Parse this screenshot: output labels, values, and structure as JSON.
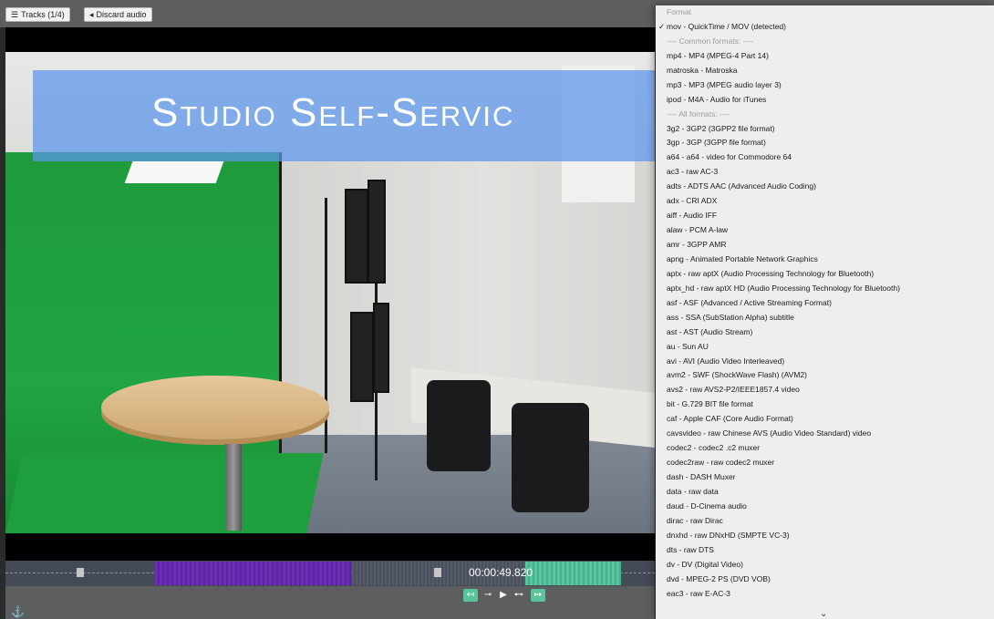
{
  "toolbar": {
    "tracks_label": "Tracks (1/4)",
    "discard_label": "Discard audio"
  },
  "video": {
    "banner_text": "Studio Self-Servic"
  },
  "timeline": {
    "timecode": "00:00:49.820"
  },
  "format_menu": {
    "title": "Format",
    "selected": "mov - QuickTime / MOV (detected)",
    "common_header": "---- Common formats: ----",
    "common": [
      "mp4 - MP4 (MPEG-4 Part 14)",
      "matroska - Matroska",
      "mp3 - MP3 (MPEG audio layer 3)",
      "ipod - M4A - Audio for iTunes"
    ],
    "all_header": "---- All formats: ----",
    "all": [
      "3g2 - 3GP2 (3GPP2 file format)",
      "3gp - 3GP (3GPP file format)",
      "a64 - a64 - video for Commodore 64",
      "ac3 - raw AC-3",
      "adts - ADTS AAC (Advanced Audio Coding)",
      "adx - CRI ADX",
      "aiff - Audio IFF",
      "alaw - PCM A-law",
      "amr - 3GPP AMR",
      "apng - Animated Portable Network Graphics",
      "aptx - raw aptX (Audio Processing Technology for Bluetooth)",
      "aptx_hd - raw aptX HD (Audio Processing Technology for Bluetooth)",
      "asf - ASF (Advanced / Active Streaming Format)",
      "ass - SSA (SubStation Alpha) subtitle",
      "ast - AST (Audio Stream)",
      "au - Sun AU",
      "avi - AVI (Audio Video Interleaved)",
      "avm2 - SWF (ShockWave Flash) (AVM2)",
      "avs2 - raw AVS2-P2/IEEE1857.4 video",
      "bit - G.729 BIT file format",
      "caf - Apple CAF (Core Audio Format)",
      "cavsvideo - raw Chinese AVS (Audio Video Standard) video",
      "codec2 - codec2 .c2 muxer",
      "codec2raw - raw codec2 muxer",
      "dash - DASH Muxer",
      "data - raw data",
      "daud - D-Cinema audio",
      "dirac - raw Dirac",
      "dnxhd - raw DNxHD (SMPTE VC-3)",
      "dts - raw DTS",
      "dv - DV (Digital Video)",
      "dvd - MPEG-2 PS (DVD VOB)",
      "eac3 - raw E-AC-3"
    ]
  },
  "colors": {
    "toolbar_bg": "#5d5e60",
    "segment_purple": "#6b2fb5",
    "segment_teal": "#59c5a0"
  }
}
